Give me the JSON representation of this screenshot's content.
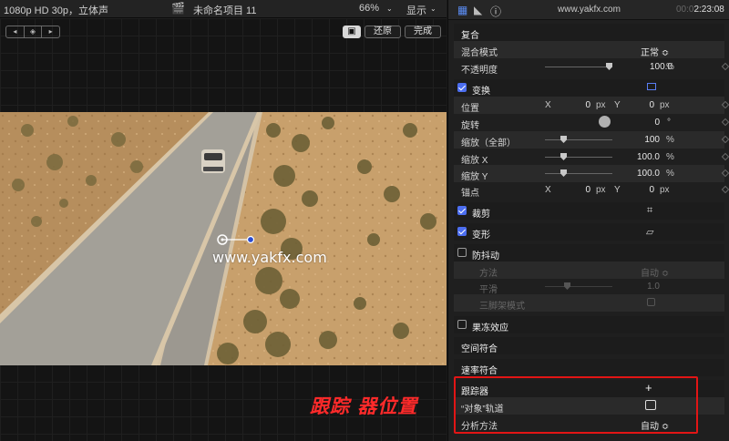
{
  "viewer": {
    "format_info": "1080p HD 30p，立体声",
    "project_title": "未命名项目 11",
    "zoom": "66%",
    "display_menu": "显示",
    "nav_prev": "◂",
    "nav_center": "◈",
    "nav_next": "▸",
    "btn_reset": "还原",
    "btn_done": "完成",
    "watermark": "www.yakfx.com",
    "caption": "跟踪 器位置"
  },
  "inspector": {
    "site": "www.yakfx.com",
    "timecode_dim": "00:0",
    "timecode": "2:23:08",
    "compositing": {
      "header": "复合",
      "blend_label": "混合模式",
      "blend_value": "正常 ≎",
      "opacity_label": "不透明度",
      "opacity_value": "100.0",
      "opacity_unit": "%"
    },
    "transform": {
      "header": "变换",
      "position_label": "位置",
      "x": "X",
      "y": "Y",
      "pos_x": "0",
      "pos_y": "0",
      "px": "px",
      "rotation_label": "旋转",
      "rotation_value": "0",
      "deg": "°",
      "scale_all_label": "缩放（全部）",
      "scale_all_value": "100",
      "pct": "%",
      "scale_x_label": "缩放 X",
      "scale_x_value": "100.0",
      "scale_y_label": "缩放 Y",
      "scale_y_value": "100.0",
      "anchor_label": "锚点",
      "anchor_x": "0",
      "anchor_y": "0"
    },
    "crop": {
      "header": "裁剪"
    },
    "distort": {
      "header": "变形"
    },
    "stabilization": {
      "header": "防抖动",
      "method_label": "方法",
      "method_value": "自动 ≎",
      "smooth_label": "平滑",
      "smooth_value": "1.0",
      "tripod_label": "三脚架模式"
    },
    "freeze": {
      "header": "果冻效应"
    },
    "spatial": {
      "header": "空间符合"
    },
    "rate": {
      "header": "速率符合"
    },
    "tracker": {
      "header": "跟踪器",
      "add": "+",
      "object_track_label": "“对象”轨道",
      "analysis_label": "分析方法",
      "analysis_value": "自动 ≎"
    }
  },
  "colors": {
    "accent": "#4c6ef0",
    "highlight_red": "#e21515"
  }
}
